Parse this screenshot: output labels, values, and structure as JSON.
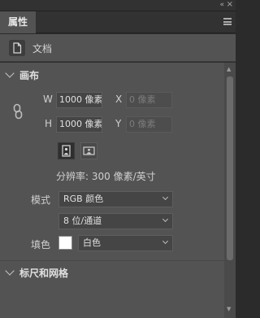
{
  "header": {
    "collapse_glyph": "«",
    "close_glyph": "×"
  },
  "tab": {
    "label": "属性"
  },
  "document": {
    "label": "文档",
    "icon": "document-icon"
  },
  "canvas": {
    "title": "画布",
    "width_label": "W",
    "width_value": "1000 像素",
    "height_label": "H",
    "height_value": "1000 像素",
    "x_label": "X",
    "x_value": "0 像素",
    "y_label": "Y",
    "y_value": "0 像素",
    "resolution": "分辨率: 300 像素/英寸",
    "mode_label": "模式",
    "mode_value": "RGB 颜色",
    "depth_value": "8 位/通道",
    "fill_label": "填色",
    "fill_value": "白色",
    "fill_color": "#ffffff"
  },
  "rulers": {
    "title": "标尺和网格"
  },
  "colors": {
    "panel_bg": "#535353",
    "dark_bg": "#323232",
    "field_bg": "#454545"
  }
}
